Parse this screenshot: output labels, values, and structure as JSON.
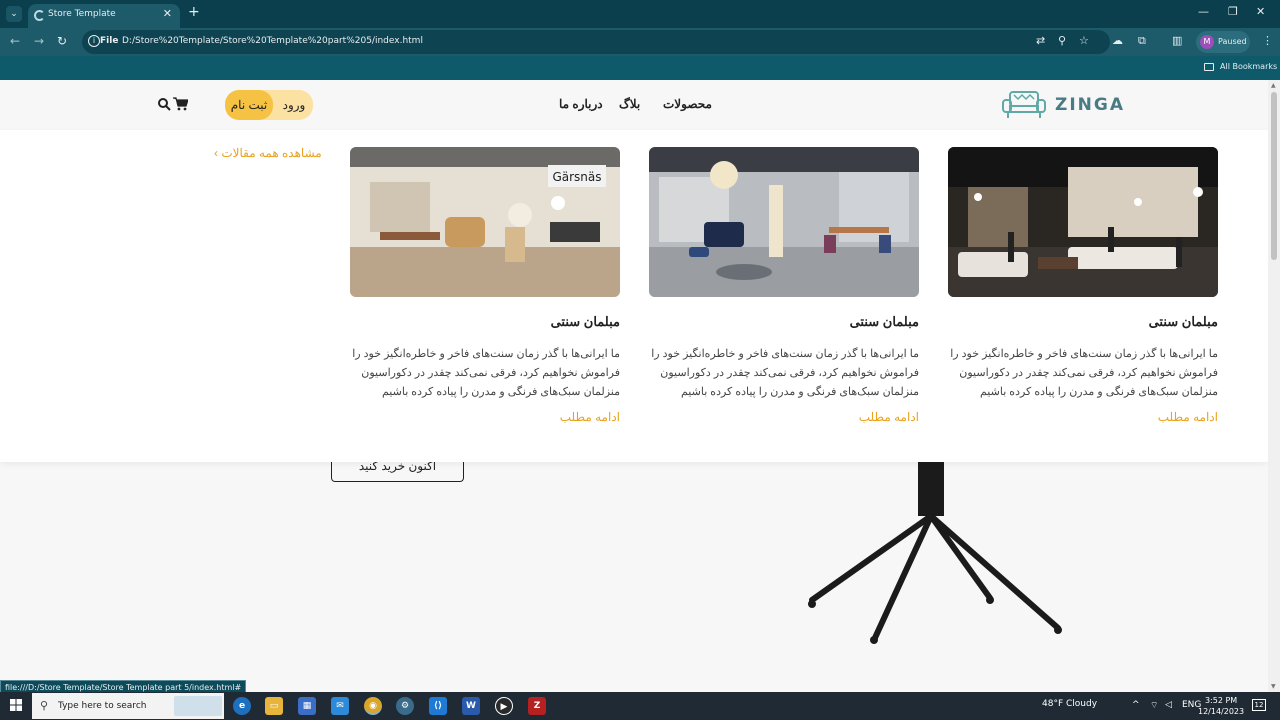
{
  "browser": {
    "tab_title": "Store Template",
    "url_scheme": "File",
    "url": "D:/Store%20Template/Store%20Template%20part%205/index.html",
    "profile_initial": "M",
    "profile_status": "Paused",
    "bookmarks_label": "All Bookmarks",
    "status_url": "file:///D:/Store Template/Store Template part 5/index.html#"
  },
  "site": {
    "logo_text": "ZINGA",
    "nav": {
      "products": "محصولات",
      "blog": "بلاگ",
      "about": "درباره ما"
    },
    "auth": {
      "signup": "ثبت نام",
      "login": "ورود"
    },
    "dropdown": {
      "all_articles": "مشاهده همه مقالات",
      "cards": [
        {
          "title": "مبلمان سنتی",
          "text": "ما ایرانی‌ها با گذر زمان سنت‌های فاخر و خاطره‌انگیز خود را فراموش نخواهیم کرد، فرقی نمی‌کند چقدر در دکوراسیون منزلمان سبک‌های فرنگی و مدرن را پیاده کرده باشیم",
          "more": "ادامه مطلب"
        },
        {
          "title": "مبلمان سنتی",
          "text": "ما ایرانی‌ها با گذر زمان سنت‌های فاخر و خاطره‌انگیز خود را فراموش نخواهیم کرد، فرقی نمی‌کند چقدر در دکوراسیون منزلمان سبک‌های فرنگی و مدرن را پیاده کرده باشیم",
          "more": "ادامه مطلب"
        },
        {
          "title": "مبلمان سنتی",
          "text": "ما ایرانی‌ها با گذر زمان سنت‌های فاخر و خاطره‌انگیز خود را فراموش نخواهیم کرد، فرقی نمی‌کند چقدر در دکوراسیون منزلمان سبک‌های فرنگی و مدرن را پیاده کرده باشیم",
          "more": "ادامه مطلب"
        }
      ],
      "gallery_sign": "Gärsnäs"
    },
    "hero": {
      "buy_button": "اکنون خرید کنید"
    }
  },
  "taskbar": {
    "search_placeholder": "Type here to search",
    "weather": "48°F  Cloudy",
    "lang": "ENG",
    "time": "3:52 PM",
    "date": "12/14/2023",
    "notifications": "12"
  },
  "colors": {
    "accent": "#f6c243",
    "link": "#e9a21e",
    "chrome": "#1d5a6a"
  }
}
